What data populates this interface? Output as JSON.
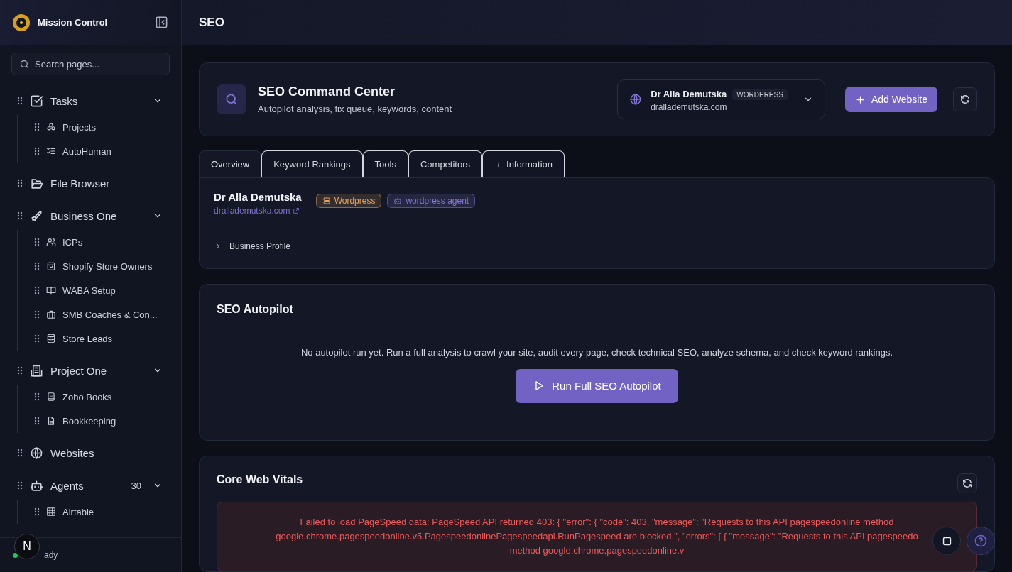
{
  "brand": {
    "title": "Mission Control"
  },
  "search": {
    "placeholder": "Search pages..."
  },
  "nav": [
    {
      "label": "Tasks",
      "expanded": true,
      "children": [
        {
          "label": "Projects"
        },
        {
          "label": "AutoHuman"
        }
      ]
    },
    {
      "label": "File Browser"
    },
    {
      "label": "Business One",
      "expanded": true,
      "children": [
        {
          "label": "ICPs"
        },
        {
          "label": "Shopify Store Owners"
        },
        {
          "label": "WABA Setup"
        },
        {
          "label": "SMB Coaches & Con..."
        },
        {
          "label": "Store Leads"
        }
      ]
    },
    {
      "label": "Project One",
      "expanded": true,
      "children": [
        {
          "label": "Zoho Books"
        },
        {
          "label": "Bookkeeping"
        }
      ]
    },
    {
      "label": "Websites"
    },
    {
      "label": "Agents",
      "count": "30",
      "expanded": true,
      "children": [
        {
          "label": "Airtable"
        }
      ]
    }
  ],
  "status": {
    "avatar": "N",
    "text": "ady",
    "color": "#22c55e"
  },
  "page_title": "SEO",
  "header": {
    "title": "SEO Command Center",
    "subtitle": "Autopilot analysis, fix queue, keywords, content",
    "site": {
      "name": "Dr Alla Demutska",
      "badge": "WORDPRESS",
      "domain": "drallademutska.com"
    },
    "add_button": "Add Website"
  },
  "tabs": [
    {
      "label": "Overview",
      "selected": true
    },
    {
      "label": "Keyword Rankings",
      "selected": false
    },
    {
      "label": "Tools",
      "selected": false
    },
    {
      "label": "Competitors",
      "selected": false
    },
    {
      "label": "Information",
      "selected": false,
      "info_icon": true
    }
  ],
  "profile": {
    "name": "Dr Alla Demutska",
    "link": "drallademutska.com",
    "tags": [
      {
        "label": "Wordpress",
        "color": "#e8a25a"
      },
      {
        "label": "wordpress agent",
        "color": "#8576d8"
      }
    ],
    "section": "Business Profile",
    "expanded": false
  },
  "autopilot": {
    "title": "SEO Autopilot",
    "message": "No autopilot run yet. Run a full analysis to crawl your site, audit every page, check technical SEO, analyze schema, and check keyword rankings.",
    "button": "Run Full SEO Autopilot"
  },
  "vitals": {
    "title": "Core Web Vitals",
    "error": "Failed to load PageSpeed data: PageSpeed API returned 403: { \"error\": { \"code\": 403, \"message\": \"Requests to this API pagespeedonline method google.chrome.pagespeedonline.v5.PagespeedonlinePagespeedapi.RunPagespeed are blocked.\", \"errors\": [ { \"message\": \"Requests to this API pagespeedo method google.chrome.pagespeedonline.v"
  }
}
